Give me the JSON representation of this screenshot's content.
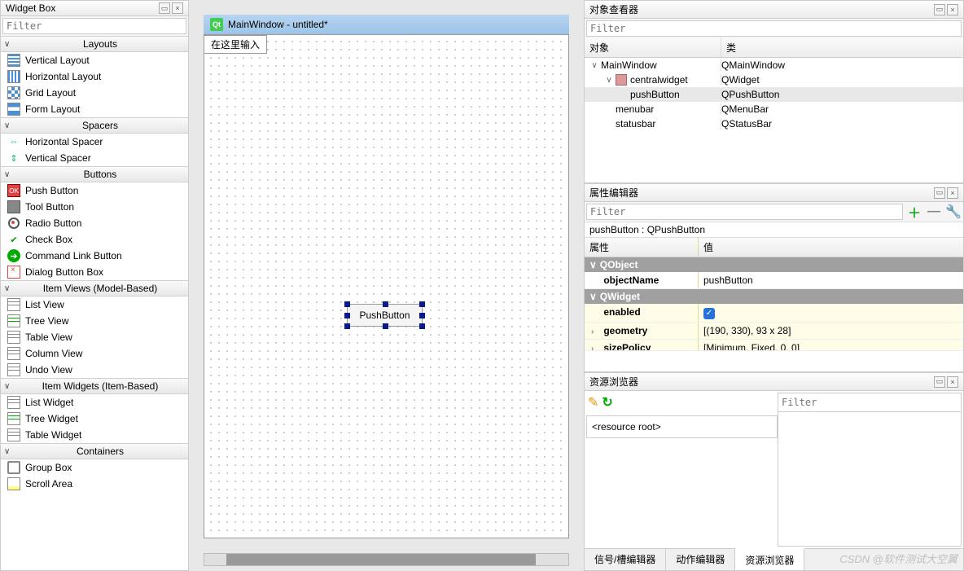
{
  "widgetBox": {
    "title": "Widget Box",
    "filterPlaceholder": "Filter",
    "categories": [
      {
        "name": "Layouts",
        "items": [
          {
            "label": "Vertical Layout",
            "icon": "ic-vlayout"
          },
          {
            "label": "Horizontal Layout",
            "icon": "ic-hlayout"
          },
          {
            "label": "Grid Layout",
            "icon": "ic-grid"
          },
          {
            "label": "Form Layout",
            "icon": "ic-form"
          }
        ]
      },
      {
        "name": "Spacers",
        "items": [
          {
            "label": "Horizontal Spacer",
            "icon": "ic-hspacer",
            "glyph": "⇔"
          },
          {
            "label": "Vertical Spacer",
            "icon": "ic-vspacer",
            "glyph": "⇕"
          }
        ]
      },
      {
        "name": "Buttons",
        "items": [
          {
            "label": "Push Button",
            "icon": "ic-pushbtn",
            "glyph": "OK"
          },
          {
            "label": "Tool Button",
            "icon": "ic-toolbtn"
          },
          {
            "label": "Radio Button",
            "icon": "ic-radio"
          },
          {
            "label": "Check Box",
            "icon": "ic-check",
            "glyph": "✔"
          },
          {
            "label": "Command Link Button",
            "icon": "ic-cmdlink",
            "glyph": "➔"
          },
          {
            "label": "Dialog Button Box",
            "icon": "ic-dlgbox"
          }
        ]
      },
      {
        "name": "Item Views (Model-Based)",
        "items": [
          {
            "label": "List View",
            "icon": "ic-view"
          },
          {
            "label": "Tree View",
            "icon": "ic-view ic-tree"
          },
          {
            "label": "Table View",
            "icon": "ic-view"
          },
          {
            "label": "Column View",
            "icon": "ic-view"
          },
          {
            "label": "Undo View",
            "icon": "ic-view"
          }
        ]
      },
      {
        "name": "Item Widgets (Item-Based)",
        "items": [
          {
            "label": "List Widget",
            "icon": "ic-view"
          },
          {
            "label": "Tree Widget",
            "icon": "ic-view ic-tree"
          },
          {
            "label": "Table Widget",
            "icon": "ic-view"
          }
        ]
      },
      {
        "name": "Containers",
        "items": [
          {
            "label": "Group Box",
            "icon": "ic-groupbox"
          },
          {
            "label": "Scroll Area",
            "icon": "ic-scrollarea"
          }
        ]
      }
    ]
  },
  "canvas": {
    "windowTitle": "MainWindow - untitled*",
    "placeholder": "在这里输入",
    "buttonText": "PushButton"
  },
  "objectInspector": {
    "title": "对象查看器",
    "filterPlaceholder": "Filter",
    "col1": "对象",
    "col2": "类",
    "rows": [
      {
        "name": "MainWindow",
        "cls": "QMainWindow",
        "indent": 0,
        "expand": "∨"
      },
      {
        "name": "centralwidget",
        "cls": "QWidget",
        "indent": 1,
        "expand": "∨",
        "icon": true
      },
      {
        "name": "pushButton",
        "cls": "QPushButton",
        "indent": 2,
        "sel": true
      },
      {
        "name": "menubar",
        "cls": "QMenuBar",
        "indent": 1
      },
      {
        "name": "statusbar",
        "cls": "QStatusBar",
        "indent": 1
      }
    ]
  },
  "propertyEditor": {
    "title": "属性编辑器",
    "filterPlaceholder": "Filter",
    "objectLabel": "pushButton : QPushButton",
    "col1": "属性",
    "col2": "值",
    "sections": [
      {
        "name": "QObject",
        "rows": [
          {
            "name": "objectName",
            "value": "pushButton"
          }
        ]
      },
      {
        "name": "QWidget",
        "rows": [
          {
            "name": "enabled",
            "value": "check",
            "yellow": true
          },
          {
            "name": "geometry",
            "value": "[(190, 330), 93 x 28]",
            "yellow": true,
            "expand": true
          },
          {
            "name": "sizePolicy",
            "value": "[Minimum, Fixed, 0, 0]",
            "yellow": true,
            "expand": true,
            "cut": true
          }
        ]
      }
    ]
  },
  "resourceBrowser": {
    "title": "资源浏览器",
    "rootLabel": "<resource root>",
    "filterPlaceholder": "Filter",
    "tabs": [
      "信号/槽编辑器",
      "动作编辑器",
      "资源浏览器"
    ],
    "activeTab": 2
  },
  "watermark": "CSDN @软件测试大空翼"
}
